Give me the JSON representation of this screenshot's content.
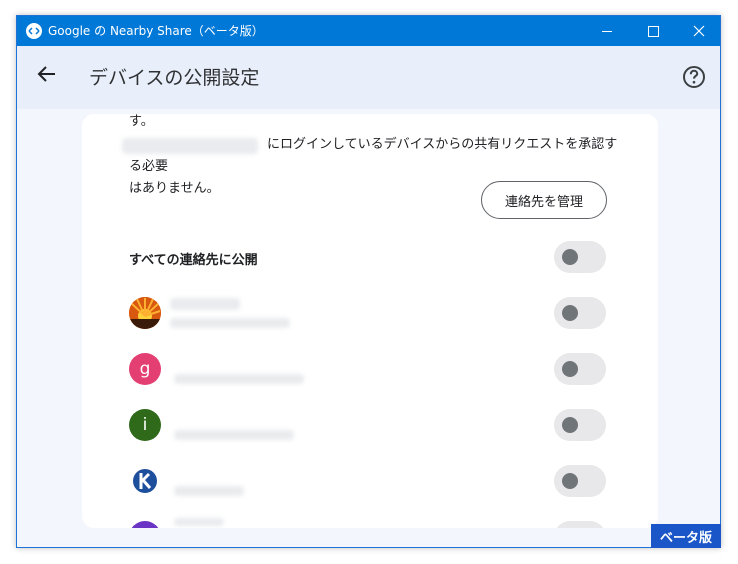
{
  "window": {
    "title": "Google の Nearby Share（ベータ版）",
    "app_icon": "nearby-share-icon"
  },
  "appbar": {
    "title": "デバイスの公開設定",
    "back_icon": "arrow-left-icon",
    "help_icon": "help-circle-icon"
  },
  "card": {
    "cut_text": "す。",
    "description_part1": "にログインしているデバイスからの共有リクエストを承認する必要",
    "description_part2": "はありません。",
    "manage_button": "連絡先を管理",
    "all_contacts_label": "すべての連絡先に公開",
    "contacts": [
      {
        "avatar": "sunset-photo",
        "avatar_color": "#e8731c",
        "letter": ""
      },
      {
        "avatar": "letter",
        "avatar_color": "#e43f72",
        "letter": "g"
      },
      {
        "avatar": "letter",
        "avatar_color": "#2e6a1a",
        "letter": "i"
      },
      {
        "avatar": "k-logo",
        "avatar_color": "#1a4fa0",
        "letter": ""
      },
      {
        "avatar": "letter",
        "avatar_color": "#6a35c4",
        "letter": ""
      }
    ]
  },
  "badge": {
    "label": "ベータ版"
  },
  "colors": {
    "titlebar": "#0078d7",
    "badge": "#1a56c7",
    "toggle_off_track": "#e8e8ea",
    "toggle_off_knob": "#70757a"
  }
}
